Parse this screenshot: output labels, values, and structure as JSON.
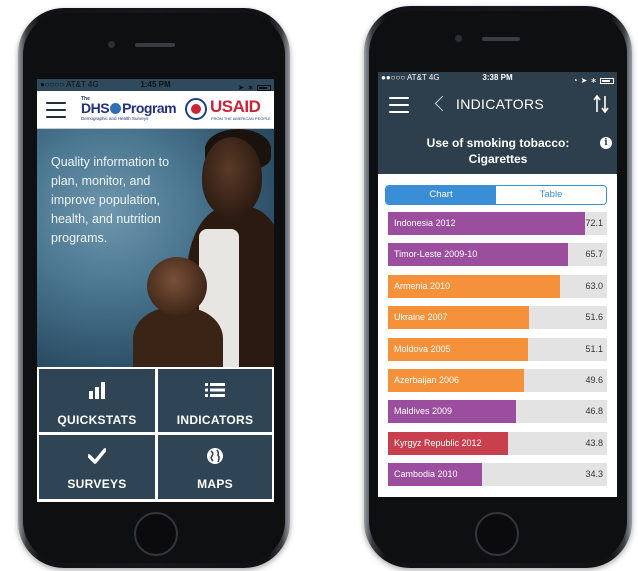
{
  "phone_left": {
    "status": {
      "carrier": "●○○○○ AT&T  4G",
      "time": "1:45 PM"
    },
    "header": {
      "logo_the": "The",
      "logo_dhs": "DHS",
      "logo_program": "Program",
      "logo_sub": "Demographic and Health Surveys",
      "usaid": "USAID",
      "usaid_sub": "FROM THE AMERICAN PEOPLE"
    },
    "hero_text": "Quality information to plan, monitor, and improve population, health, and nutrition programs.",
    "tiles": [
      {
        "label": "QUICKSTATS",
        "icon": "bar-chart-icon"
      },
      {
        "label": "INDICATORS",
        "icon": "list-icon"
      },
      {
        "label": "SURVEYS",
        "icon": "checkmark-icon"
      },
      {
        "label": "MAPS",
        "icon": "globe-icon"
      }
    ]
  },
  "phone_right": {
    "status": {
      "carrier": "●●○○○ AT&T  4G",
      "time": "3:38 PM"
    },
    "nav_title": "INDICATORS",
    "indicator_title": "Use of smoking tobacco: Cigarettes",
    "info_glyph": "i",
    "tabs": {
      "chart": "Chart",
      "table": "Table",
      "selected": "Chart"
    },
    "chart_data": {
      "type": "bar",
      "orientation": "horizontal",
      "xlim": [
        0,
        80
      ],
      "bars": [
        {
          "label": "Indonesia 2012",
          "value": 72.1,
          "display": "72.1",
          "color": "#9b4e9e"
        },
        {
          "label": "Timor-Leste 2009-10",
          "value": 65.7,
          "display": "65.7",
          "color": "#9b4e9e"
        },
        {
          "label": "Armenia 2010",
          "value": 63.0,
          "display": "63.0",
          "color": "#f5913a"
        },
        {
          "label": "Ukraine 2007",
          "value": 51.6,
          "display": "51.6",
          "color": "#f5913a"
        },
        {
          "label": "Moldova 2005",
          "value": 51.1,
          "display": "51.1",
          "color": "#f5913a"
        },
        {
          "label": "Azerbaijan 2006",
          "value": 49.6,
          "display": "49.6",
          "color": "#f5913a"
        },
        {
          "label": "Maldives 2009",
          "value": 46.8,
          "display": "46.8",
          "color": "#9b4e9e"
        },
        {
          "label": "Kyrgyz Republic 2012",
          "value": 43.8,
          "display": "43.8",
          "color": "#c8404e"
        },
        {
          "label": "Cambodia 2010",
          "value": 34.3,
          "display": "34.3",
          "color": "#9b4e9e"
        }
      ]
    }
  }
}
